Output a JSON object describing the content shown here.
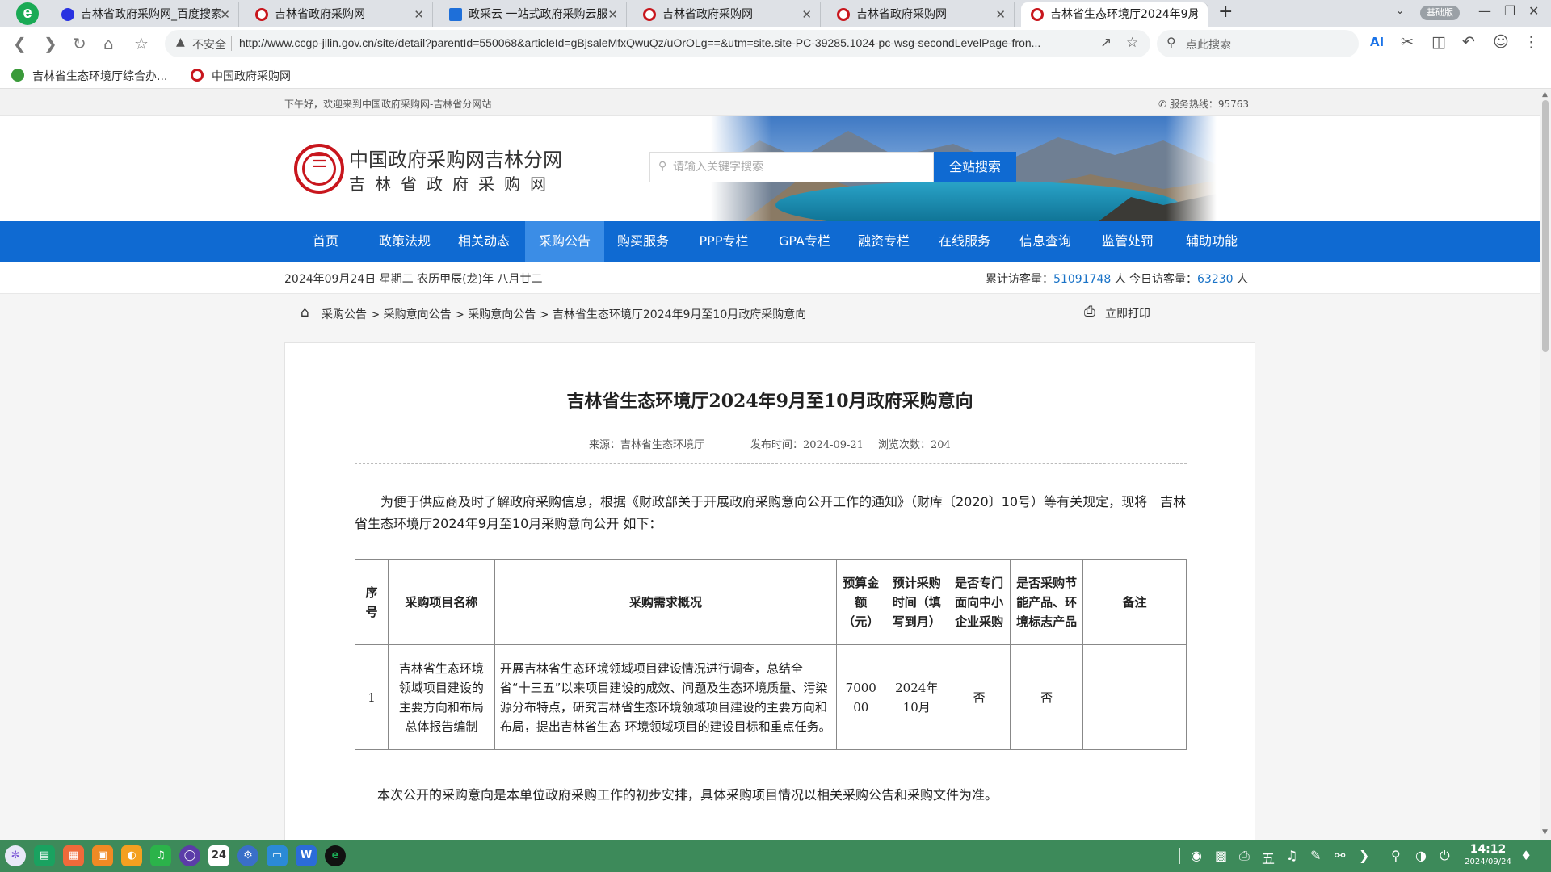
{
  "browser": {
    "tabs": [
      {
        "title": "吉林省政府采购网_百度搜索",
        "favicon": "baidu"
      },
      {
        "title": "吉林省政府采购网",
        "favicon": "ccgp"
      },
      {
        "title": "政采云 一站式政府采购云服",
        "favicon": "zcy"
      },
      {
        "title": "吉林省政府采购网",
        "favicon": "ccgp"
      },
      {
        "title": "吉林省政府采购网",
        "favicon": "ccgp"
      },
      {
        "title": "吉林省生态环境厅2024年9月",
        "favicon": "ccgp"
      }
    ],
    "active_tab_index": 5,
    "edition_badge": "基础版",
    "security_label": "不安全",
    "url": "http://www.ccgp-jilin.gov.cn/site/detail?parentId=550068&articleId=gBjsaleMfxQwuQz/uOrOLg==&utm=site.site-PC-39285.1024-pc-wsg-secondLevelPage-fron...",
    "search_placeholder": "点此搜索",
    "bookmarks": [
      "吉林省生态环境厅综合办...",
      "中国政府采购网"
    ]
  },
  "site": {
    "greeting": "下午好，欢迎来到中国政府采购网-吉林省分网站",
    "hotline": "服务热线：95763",
    "title": "中国政府采购网吉林分网",
    "subtitle": "吉林省政府采购网",
    "keyword_placeholder": "请输入关键字搜索",
    "search_button": "全站搜索",
    "nav": [
      "首页",
      "政策法规",
      "相关动态",
      "采购公告",
      "购买服务",
      "PPP专栏",
      "GPA专栏",
      "融资专栏",
      "在线服务",
      "信息查询",
      "监管处罚",
      "辅助功能"
    ],
    "active_nav_index": 3,
    "date": "2024年09月24日 星期二 农历甲辰(龙)年 八月廿二",
    "total_visits_label": "累计访客量：",
    "total_visits": "51091748",
    "today_visits_label": "今日访客量：",
    "today_visits": "63230",
    "visits_unit": "人"
  },
  "breadcrumb": {
    "text": "采购公告 > 采购意向公告 > 采购意向公告 > 吉林省生态环境厅2024年9月至10月政府采购意向",
    "print": "立即打印"
  },
  "article": {
    "title": "吉林省生态环境厅2024年9月至10月政府采购意向",
    "source": "来源：吉林省生态环境厅",
    "publish_time": "发布时间：2024-09-21",
    "views": "浏览次数：204",
    "intro": "为便于供应商及时了解政府采购信息，根据《财政部关于开展政府采购意向公开工作的通知》（财库〔2020〕10号）等有关规定，现将　吉林省生态环境厅2024年9月至10月采购意向公开 如下：",
    "table": {
      "headers": [
        "序号",
        "采购项目名称",
        "采购需求概况",
        "预算金额（元）",
        "预计采购时间（填写到月）",
        "是否专门面向中小企业采购",
        "是否采购节能产品、环境标志产品",
        "备注"
      ],
      "rows": [
        {
          "no": "1",
          "name": "吉林省生态环境领域项目建设的主要方向和布局总体报告编制",
          "summary": "开展吉林省生态环境领域项目建设情况进行调查，总结全省“十三五”以来项目建设的成效、问题及生态环境质量、污染源分布特点，研究吉林省生态环境领域项目建设的主要方向和布局，提出吉林省生态 环境领域项目的建设目标和重点任务。",
          "budget": "700000",
          "time": "2024年10月",
          "sme": "否",
          "green": "否",
          "remark": ""
        }
      ]
    },
    "closing": "本次公开的采购意向是本单位政府采购工作的初步安排，具体采购项目情况以相关采购公告和采购文件为准。"
  },
  "taskbar": {
    "time": "14:12",
    "date": "2024/09/24"
  }
}
